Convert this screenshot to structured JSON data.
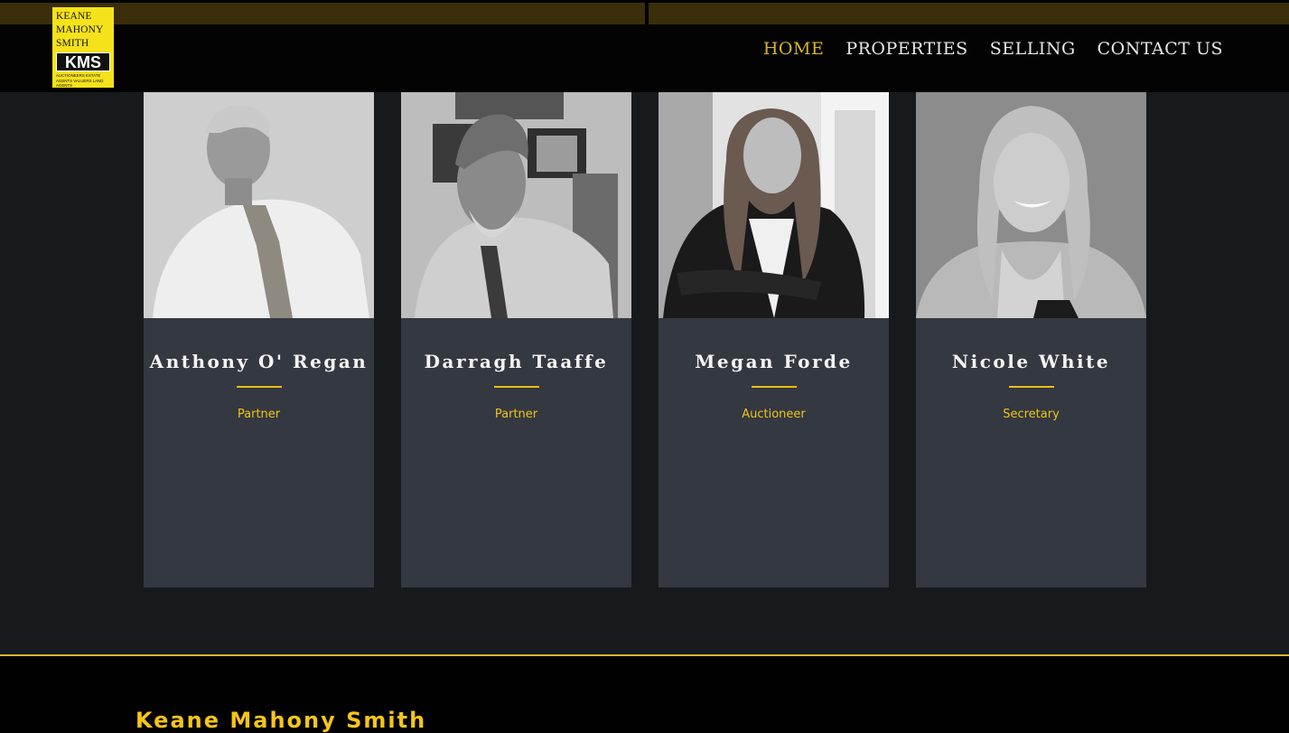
{
  "logo": {
    "lines": [
      "KEANE",
      "MAHONY",
      "SMITH"
    ],
    "monogram": "KMS",
    "tagline": "AUCTIONEERS  ESTATE AGENTS  VALUERS  LAND AGENTS"
  },
  "nav": [
    {
      "label": "HOME",
      "active": true
    },
    {
      "label": "PROPERTIES",
      "active": false
    },
    {
      "label": "SELLING",
      "active": false
    },
    {
      "label": "CONTACT US",
      "active": false
    }
  ],
  "team": [
    {
      "name": "Anthony O' Regan",
      "role": "Partner"
    },
    {
      "name": "Darragh Taaffe",
      "role": "Partner"
    },
    {
      "name": "Megan Forde",
      "role": "Auctioneer"
    },
    {
      "name": "Nicole White",
      "role": "Secretary"
    }
  ],
  "footer": {
    "brand": "Keane Mahony Smith"
  },
  "colors": {
    "accent": "#d8b42d",
    "card": "#343840",
    "background": "#171a1d"
  }
}
